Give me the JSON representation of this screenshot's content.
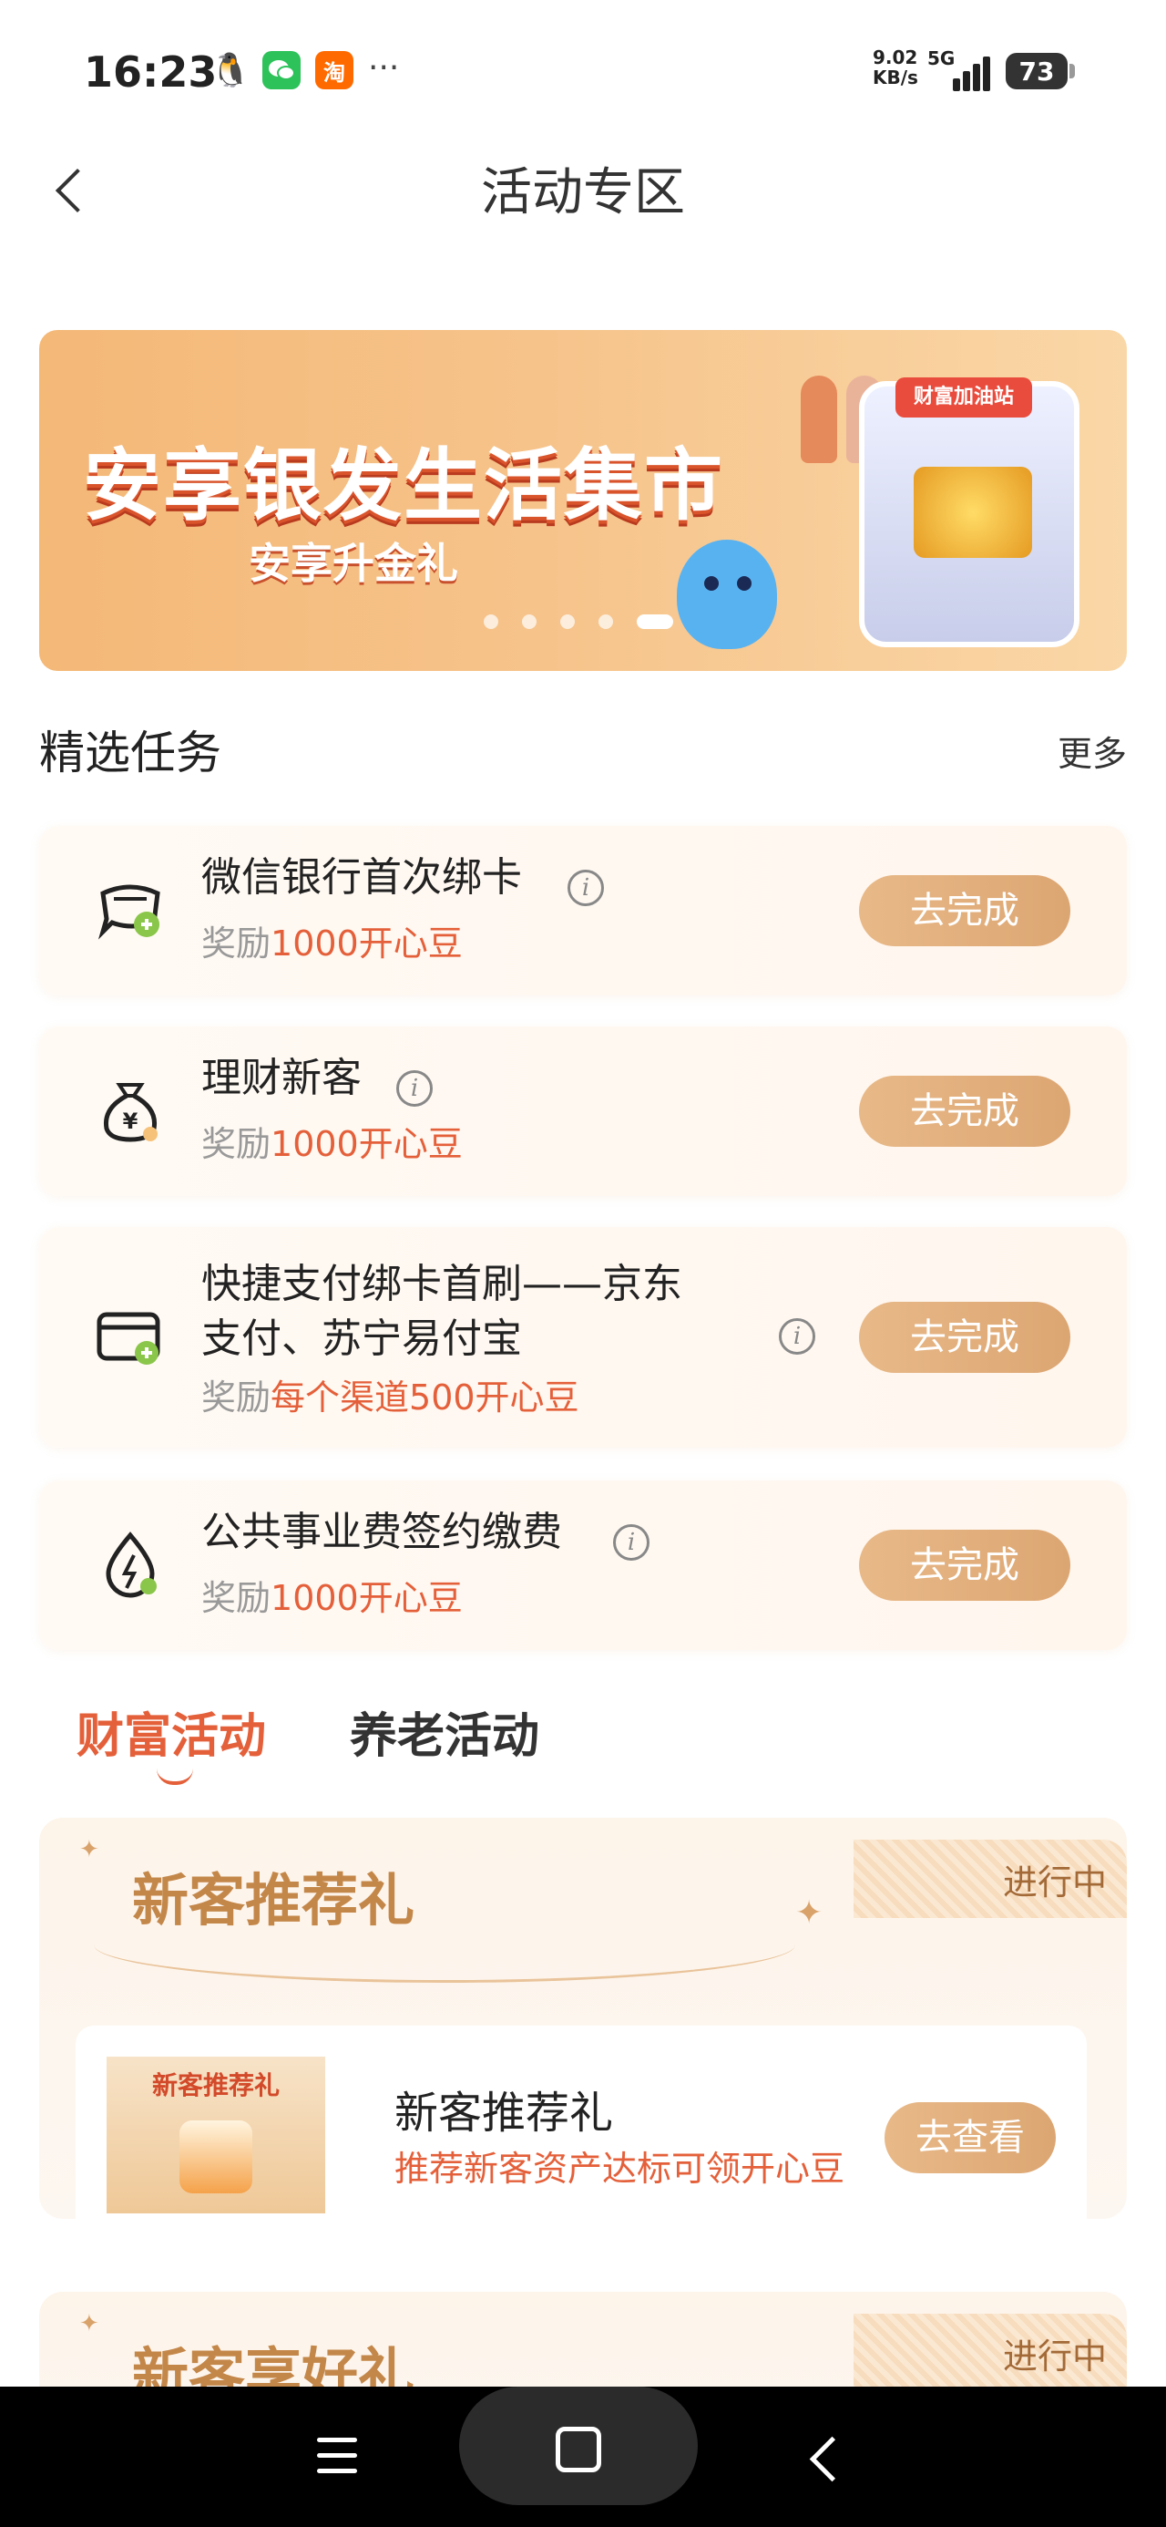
{
  "status_bar": {
    "time": "16:23",
    "net_speed": "9.02",
    "net_unit": "KB/s",
    "network_type": "5G",
    "battery": "73",
    "app_icons": [
      "qq-icon",
      "wechat-icon",
      "taobao-icon"
    ],
    "taobao_glyph": "淘",
    "more": "···"
  },
  "header": {
    "title": "活动专区"
  },
  "banner": {
    "title": "安享银发生活集市",
    "subtitle": "安享升金礼",
    "sign": "财富加油站",
    "slide_count": 5,
    "active_slide": 5
  },
  "tasks_section": {
    "title": "精选任务",
    "more_label": "更多"
  },
  "tasks": [
    {
      "name": "微信银行首次绑卡",
      "reward_prefix": "奖励",
      "reward_amount": "1000开心豆",
      "button": "去完成"
    },
    {
      "name": "理财新客",
      "reward_prefix": "奖励",
      "reward_amount": "1000开心豆",
      "button": "去完成"
    },
    {
      "name_line1": "快捷支付绑卡首刷——京东",
      "name_line2": "支付、苏宁易付宝",
      "reward_prefix": "奖励",
      "reward_amount": "每个渠道500开心豆",
      "button": "去完成"
    },
    {
      "name": "公共事业费签约缴费",
      "reward_prefix": "奖励",
      "reward_amount": "1000开心豆",
      "button": "去完成"
    }
  ],
  "activity_tabs": [
    {
      "label": "财富活动",
      "active": true
    },
    {
      "label": "养老活动",
      "active": false
    }
  ],
  "activities": [
    {
      "header_title": "新客推荐礼",
      "status": "进行中",
      "thumb_title": "新客推荐礼",
      "name": "新客推荐礼",
      "description": "推荐新客资产达标可领开心豆",
      "button": "去查看"
    },
    {
      "header_title": "新客享好礼",
      "status": "进行中"
    }
  ],
  "info_glyph": "i",
  "colors": {
    "accent": "#e4603a",
    "button_gold": "#dca672",
    "activity_title": "#c4874a"
  }
}
